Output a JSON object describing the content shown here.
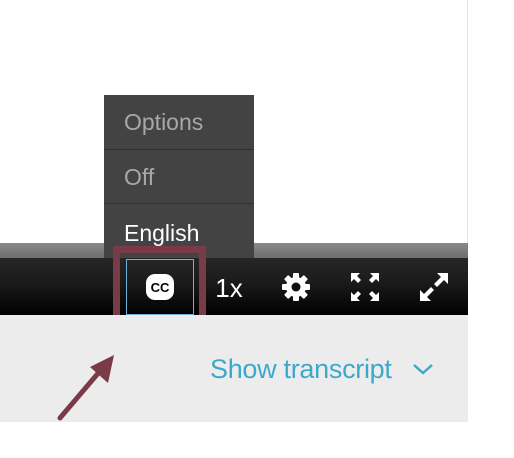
{
  "caption_menu": {
    "header": "Options",
    "items": [
      {
        "label": "Off",
        "selected": false
      },
      {
        "label": "English",
        "selected": true
      }
    ]
  },
  "controls": {
    "captions_icon": "cc-icon",
    "captions_glyph": "CC",
    "speed_label": "1x",
    "settings_icon": "gear-icon",
    "zoom_icon": "expand-arrows-icon",
    "fullscreen_icon": "fullscreen-icon"
  },
  "transcript": {
    "label": "Show transcript",
    "icon": "chevron-down-icon"
  },
  "colors": {
    "accent": "#3ea8cc",
    "highlight_box": "#7a3a47",
    "menu_background": "#434343",
    "control_bar": "#1a1a1a"
  }
}
